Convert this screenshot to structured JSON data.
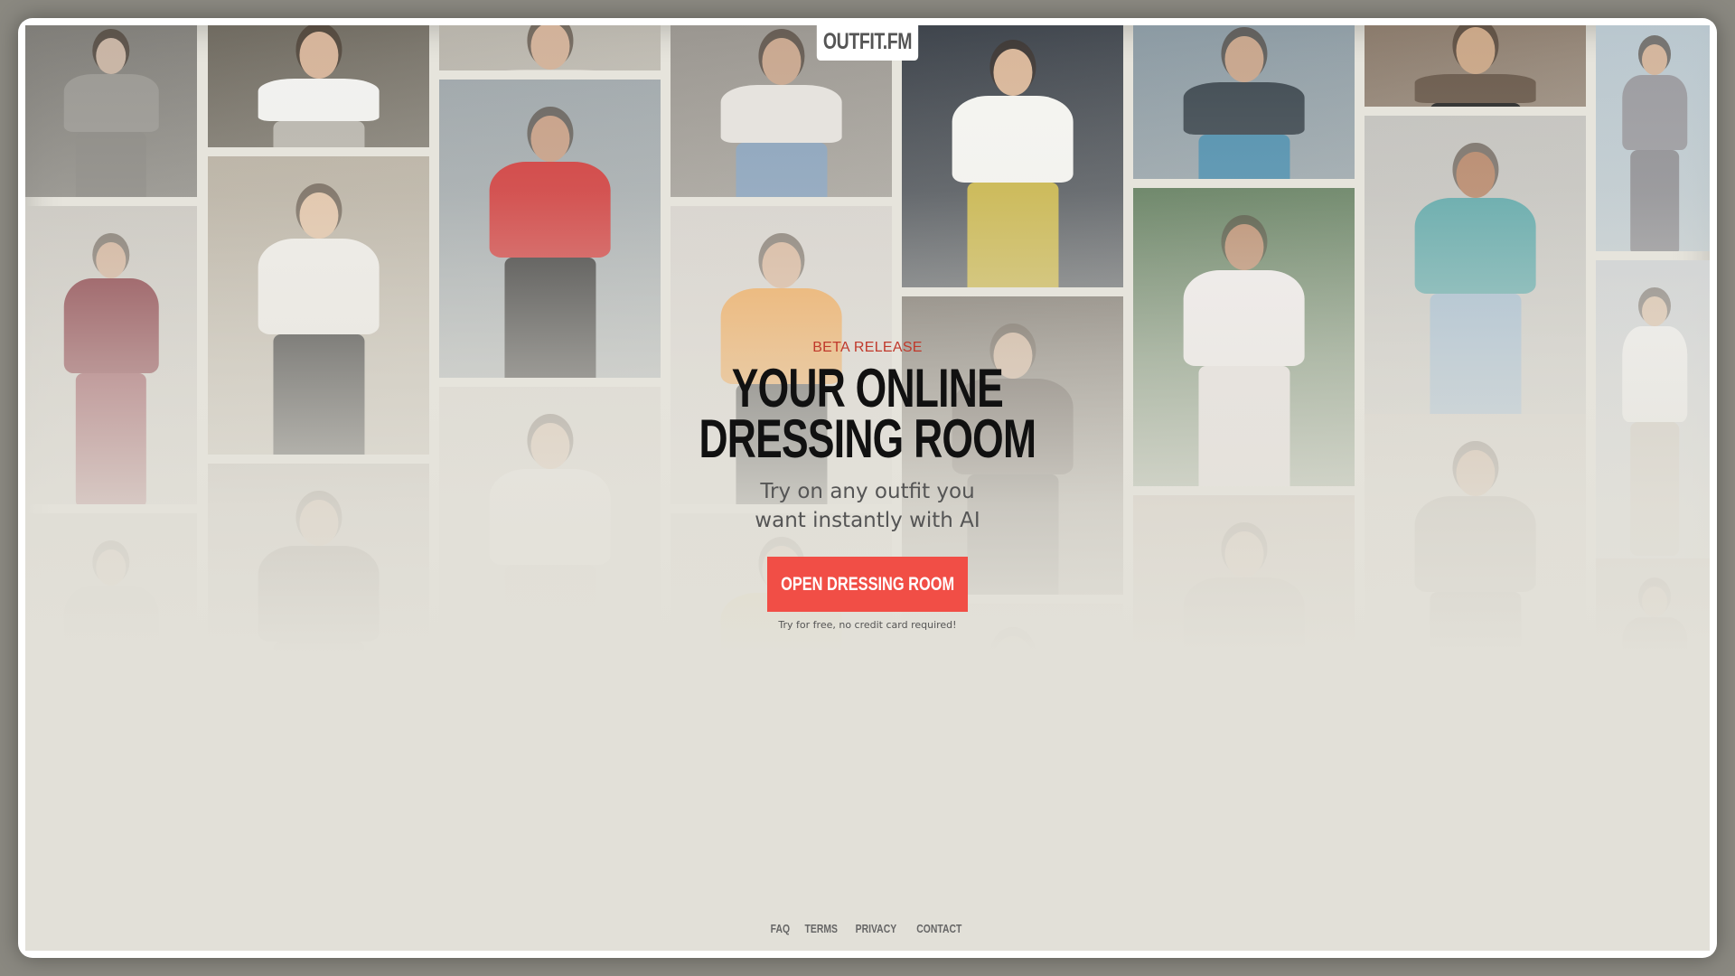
{
  "brand": {
    "logo_text": "OUTFIT.FM"
  },
  "hero": {
    "eyebrow": "BETA RELEASE",
    "headline_line1": "YOUR ONLINE",
    "headline_line2": "DRESSING ROOM",
    "subhead": "Try on any outfit you want instantly with AI",
    "cta_label": "OPEN DRESSING ROOM",
    "cta_note": "Try for free, no credit card required!"
  },
  "footer": {
    "links": [
      "FAQ",
      "TERMS",
      "PRIVACY",
      "CONTACT"
    ]
  },
  "colors": {
    "accent": "#f14e46",
    "eyebrow": "#c0392b",
    "headline": "#111111",
    "background": "#e2e0d8"
  },
  "collage": {
    "photos": [
      {
        "name": "photo-woman-grey-trousers-street",
        "bg": "#7f7d78",
        "torso": "#9a9893",
        "legs": "#8a8883",
        "skin": "#c8b4a4"
      },
      {
        "name": "photo-woman-white-tee-railing",
        "bg": "#6f6a60",
        "torso": "#f2f2f0",
        "legs": "#b9b6ae",
        "skin": "#d6b49a"
      },
      {
        "name": "photo-woman-jeans-top",
        "bg": "#b7b3aa",
        "torso": "#d8d4cc",
        "legs": "#5b7fa5",
        "skin": "#d2b29a"
      },
      {
        "name": "photo-woman-jeans-bike",
        "bg": "#9a9690",
        "torso": "#e6e3de",
        "legs": "#8aa3bd",
        "skin": "#c9a890"
      },
      {
        "name": "photo-woman-white-halter-yellow-pants",
        "bg": "#3e444c",
        "torso": "#f5f5f2",
        "legs": "#c9b548",
        "skin": "#d9b79a"
      },
      {
        "name": "photo-woman-teal-trousers",
        "bg": "#8b9aa3",
        "torso": "#3f4a52",
        "legs": "#4f8fae",
        "skin": "#c8a68d"
      },
      {
        "name": "photo-woman-legs-ground",
        "bg": "#8a7a6b",
        "torso": "#6b5b4d",
        "legs": "#2a2a2a",
        "skin": "#caa788"
      },
      {
        "name": "photo-woman-grey-dress-palm",
        "bg": "#b9c7cf",
        "torso": "#9b9ba0",
        "legs": "#8f8f94",
        "skin": "#d3b59c"
      },
      {
        "name": "photo-woman-red-gown",
        "bg": "#c9c6c0",
        "torso": "#7d2a34",
        "legs": "#8e3a45",
        "skin": "#d1b098"
      },
      {
        "name": "photo-woman-la-crop-top-bridge",
        "bg": "#b8b0a2",
        "torso": "#f0eeea",
        "legs": "#1c1c1c",
        "skin": "#e2c4a8"
      },
      {
        "name": "photo-woman-red-tee-not-today",
        "bg": "#9fa7ab",
        "torso": "#d03a3a",
        "legs": "#2f2f2f",
        "skin": "#c79f86"
      },
      {
        "name": "photo-woman-orange-sweater",
        "bg": "#d7d3ce",
        "torso": "#f0a24a",
        "legs": "#3a3a3a",
        "skin": "#d8b59b"
      },
      {
        "name": "photo-woman-white-dress-palms",
        "bg": "#5d7a5a",
        "torso": "#f3eff0",
        "legs": "#e9e2e2",
        "skin": "#b98a6b"
      },
      {
        "name": "photo-woman-hawaiian-shirt-denim-shorts",
        "bg": "#c3c2be",
        "torso": "#5aa6a8",
        "legs": "#9bb7cf",
        "skin": "#b7876a"
      },
      {
        "name": "photo-woman-white-top-city",
        "bg": "#cbcfd3",
        "torso": "#f2f2f2",
        "legs": "#c8c0b6",
        "skin": "#d9bea6"
      },
      {
        "name": "photo-woman-floral-dress-profile",
        "bg": "#bdb6ae",
        "torso": "#7a6c62",
        "legs": "#6d6058",
        "skin": "#c8a48a"
      },
      {
        "name": "photo-woman-dark-hair-portrait",
        "bg": "#6b645c",
        "torso": "#4a403a",
        "legs": "#3a332e",
        "skin": "#caa98f"
      },
      {
        "name": "photo-woman-smiling-curly-hair",
        "bg": "#cfcac2",
        "torso": "#a19a90",
        "legs": "#8a847c",
        "skin": "#c9a68b"
      },
      {
        "name": "photo-woman-white-blouse-faded",
        "bg": "#d6d2cb",
        "torso": "#e8e5e0",
        "legs": "#cfcac2",
        "skin": "#d8bca4"
      },
      {
        "name": "photo-faded-doorway",
        "bg": "#b9a89a",
        "torso": "#9f8f82",
        "legs": "#8f8074",
        "skin": "#c9a88f"
      },
      {
        "name": "photo-woman-yellow-top-faded",
        "bg": "#d0ccc4",
        "torso": "#d8c36a",
        "legs": "#b9b2a8",
        "skin": "#d2b49a"
      },
      {
        "name": "photo-woman-dark-hair-faded",
        "bg": "#b9b2aa",
        "torso": "#6e635b",
        "legs": "#5a514a",
        "skin": "#c8a78e"
      },
      {
        "name": "photo-faded-left-bottom",
        "bg": "#c9c4bc",
        "torso": "#b8b2aa",
        "legs": "#aaa39b",
        "skin": "#cbb19b"
      },
      {
        "name": "photo-faded-mid-bottom",
        "bg": "#cbc6bf",
        "torso": "#bdb7af",
        "legs": "#b0aaa2",
        "skin": "#ccb39d"
      }
    ]
  }
}
